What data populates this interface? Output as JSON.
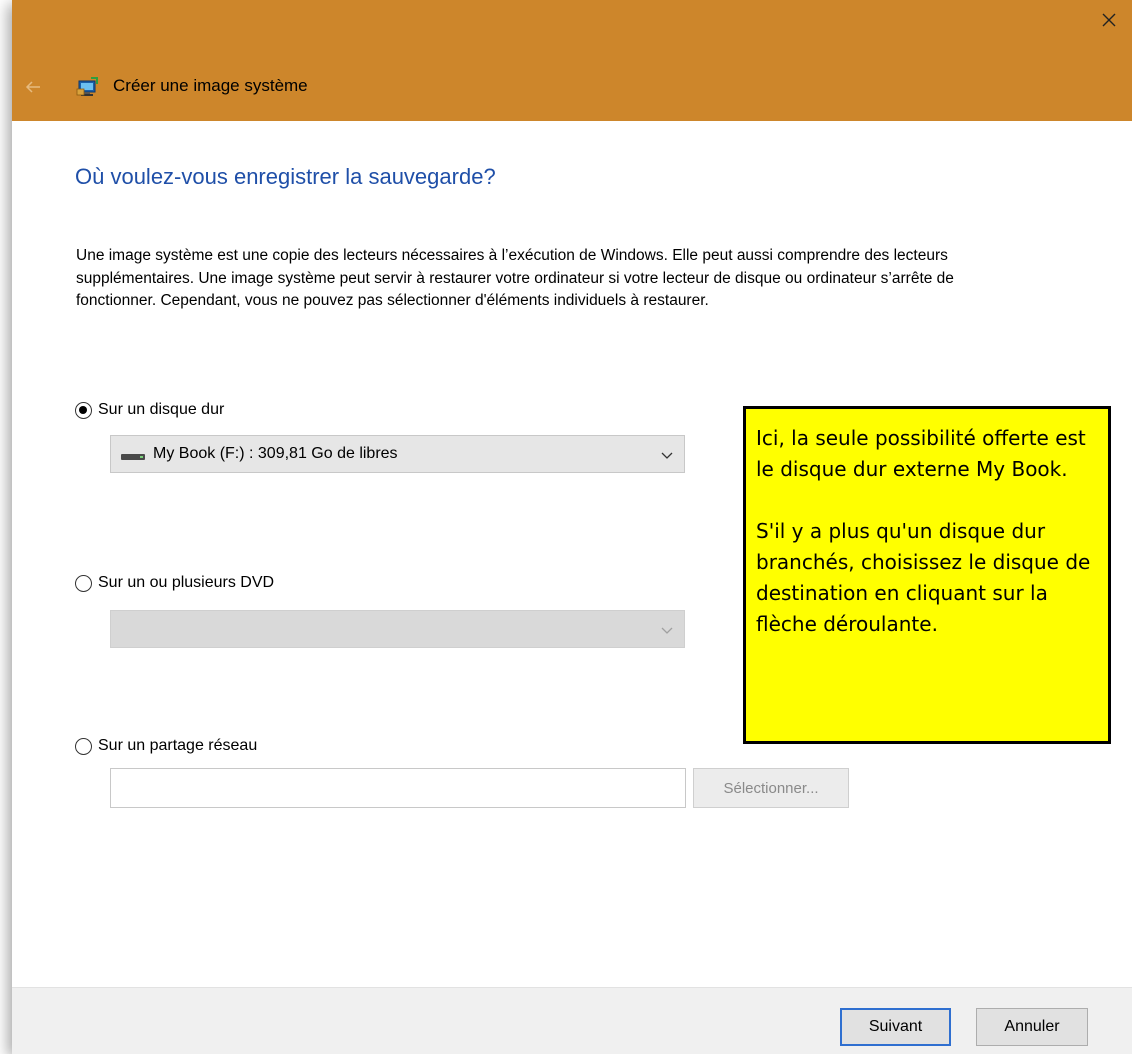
{
  "window": {
    "title": "Créer une image système",
    "accent_color": "#cd862b"
  },
  "page": {
    "heading": "Où voulez-vous enregistrer la sauvegarde?",
    "description": "Une image système est une copie des lecteurs nécessaires à l’exécution de Windows. Elle peut aussi comprendre des lecteurs supplémentaires. Une image système peut servir à restaurer votre ordinateur si votre lecteur de disque ou ordinateur s’arrête de fonctionner. Cependant, vous ne pouvez pas sélectionner d'éléments individuels à restaurer."
  },
  "options": {
    "hard_disk": {
      "label": "Sur un disque dur",
      "selected": true,
      "dropdown_value": "My Book (F:) : 309,81 Go de libres"
    },
    "dvd": {
      "label": "Sur un ou plusieurs DVD",
      "selected": false,
      "dropdown_value": ""
    },
    "network": {
      "label": "Sur un partage réseau",
      "selected": false,
      "input_value": "",
      "select_button": "Sélectionner..."
    }
  },
  "note": {
    "paragraph1": "Ici, la seule possibilité offerte est le disque dur externe My Book.",
    "paragraph2": "S'il y a plus qu'un disque dur branchés, choisissez le disque de destination en cliquant sur la flèche déroulante.",
    "background_color": "#ffff00"
  },
  "footer": {
    "next_label": "Suivant",
    "cancel_label": "Annuler"
  },
  "icons": [
    "close-icon",
    "back-arrow-icon",
    "system-image-icon",
    "drive-icon",
    "chevron-down-icon"
  ]
}
